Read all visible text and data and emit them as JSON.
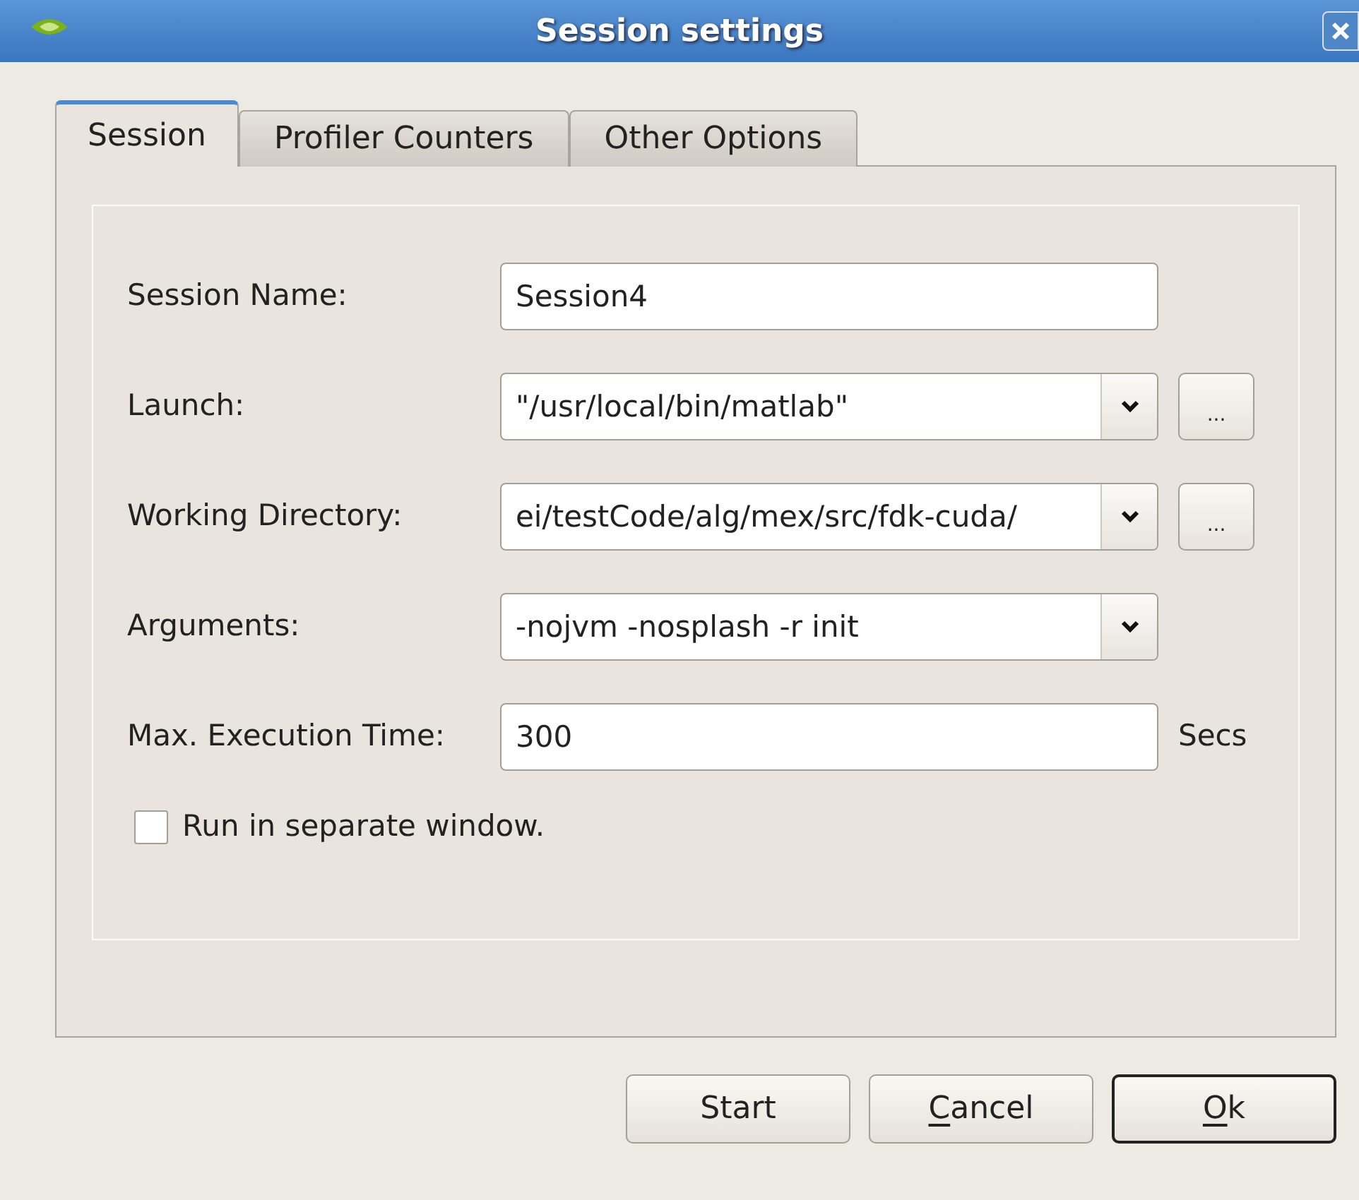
{
  "window": {
    "title": "Session settings"
  },
  "tabs": [
    {
      "label": "Session",
      "selected": true
    },
    {
      "label": "Profiler Counters",
      "selected": false
    },
    {
      "label": "Other Options",
      "selected": false
    }
  ],
  "fields": [
    {
      "label": "Session Name:",
      "kind": "text",
      "value": "Session4"
    },
    {
      "label": "Launch:",
      "kind": "combo",
      "value": "\"/usr/local/bin/matlab\"",
      "browse": "..."
    },
    {
      "label": "Working Directory:",
      "kind": "combo",
      "value": "ei/testCode/alg/mex/src/fdk-cuda/",
      "browse": "..."
    },
    {
      "label": "Arguments:",
      "kind": "combo",
      "value": "-nojvm -nosplash -r init"
    },
    {
      "label": "Max. Execution Time:",
      "kind": "text",
      "value": "300",
      "unit": "Secs"
    }
  ],
  "checkbox": {
    "label": "Run in separate window.",
    "checked": false
  },
  "buttons": [
    {
      "label": "Start",
      "underline_first": false,
      "default": false
    },
    {
      "label": "Cancel",
      "underline_first": true,
      "default": false
    },
    {
      "label": "Ok",
      "underline_first": true,
      "default": true
    }
  ]
}
